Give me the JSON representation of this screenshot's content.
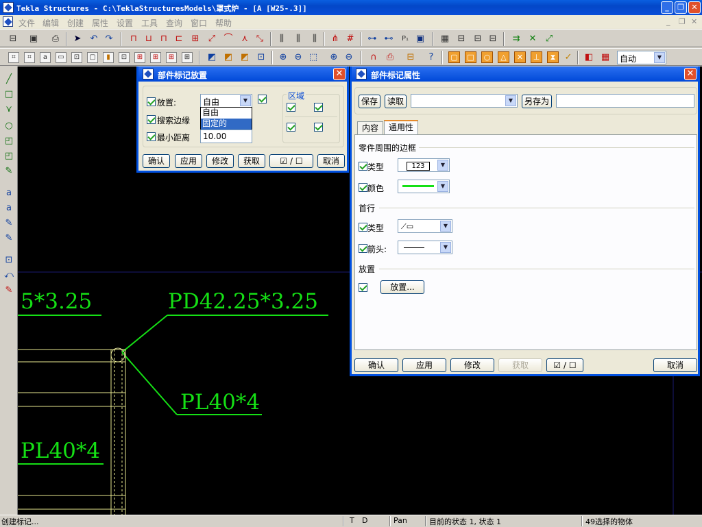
{
  "window": {
    "title": "Tekla Structures - C:\\TeklaStructuresModels\\罩式炉 - [A    [W25-.3]]"
  },
  "menu": [
    "文件",
    "编辑",
    "创建",
    "属性",
    "设置",
    "工具",
    "查询",
    "窗口",
    "帮助"
  ],
  "toolbar2": {
    "auto_combo": "自动"
  },
  "viewport": {
    "labels": [
      "5*3.25",
      "PD42.25*3.25",
      "PL40*4",
      "PL40*4"
    ],
    "line_color": "#15e015"
  },
  "placement_dialog": {
    "title": "部件标记放置",
    "placement_label": "放置:",
    "placement_value": "自由",
    "dropdown_options": [
      "自由",
      "固定的"
    ],
    "search_edge_label": "搜索边缘",
    "min_distance_label": "最小距离",
    "min_distance_value": "10.00",
    "region_label": "区域",
    "buttons": [
      "确认",
      "应用",
      "修改",
      "获取",
      "☑ / ☐",
      "取消"
    ]
  },
  "properties_dialog": {
    "title": "部件标记属性",
    "save_button": "保存",
    "load_button": "读取",
    "preset_value": "",
    "save_as_button": "另存为",
    "save_as_value": "",
    "tabs": [
      "内容",
      "通用性"
    ],
    "frame_section": "零件周围的边框",
    "type_label": "类型",
    "type_value": "123",
    "color_label": "颜色",
    "leader_section": "首行",
    "leader_type_label": "类型",
    "arrow_label": "箭头:",
    "placement_section": "放置",
    "placement_button": "放置...",
    "buttons": [
      "确认",
      "应用",
      "修改",
      "获取",
      "☑ / ☐",
      "取消"
    ]
  },
  "statusbar": {
    "message": "创建标记...",
    "t": "T",
    "d": "D",
    "pan": "Pan",
    "state": "目前的状态 1, 状态 1",
    "selected": "49选择的物体"
  }
}
